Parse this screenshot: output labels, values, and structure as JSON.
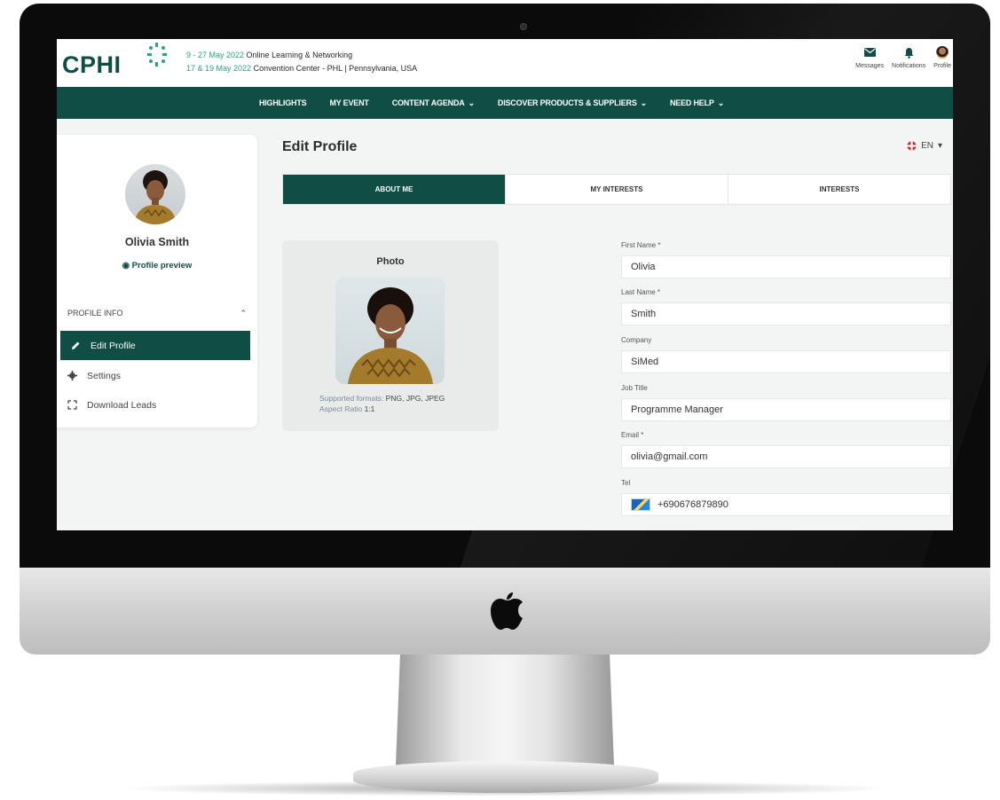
{
  "header": {
    "logo": "CPHI",
    "event_line1_date": "9 - 27 May 2022",
    "event_line1_text": " Online Learning & Networking",
    "event_line2_date": "17 & 19 May 2022",
    "event_line2_text": " Convention Center - PHL | Pennsylvania, USA",
    "icons": [
      {
        "label": "Messages",
        "icon": "envelope-icon"
      },
      {
        "label": "Notifications",
        "icon": "bell-icon"
      },
      {
        "label": "Profile",
        "icon": "avatar"
      }
    ]
  },
  "nav": {
    "items": [
      "HIGHLIGHTS",
      "MY EVENT",
      "CONTENT AGENDA",
      "DISCOVER PRODUCTS & SUPPLIERS",
      "NEED HELP"
    ],
    "dropdown_indicator": "⌄"
  },
  "sidebar": {
    "name": "Olivia Smith",
    "preview": "Profile preview",
    "section": "PROFILE INFO",
    "items": [
      {
        "label": "Edit Profile",
        "icon": "pencil-icon",
        "active": true
      },
      {
        "label": "Settings",
        "icon": "gear-icon",
        "active": false
      },
      {
        "label": "Download Leads",
        "icon": "download-frame-icon",
        "active": false
      }
    ]
  },
  "main": {
    "title": "Edit Profile",
    "language": "EN",
    "tabs": [
      "ABOUT ME",
      "MY INTERESTS",
      "INTERESTS"
    ],
    "active_tab": 0,
    "photo": {
      "label": "Photo",
      "formats_label": "Supported formats:",
      "formats_value": "PNG, JPG, JPEG",
      "ratio_label": "Aspect Ratio",
      "ratio_value": "1:1"
    },
    "form": {
      "first_name_label": "First Name *",
      "first_name": "Olivia",
      "last_name_label": "Last Name *",
      "last_name": "Smith",
      "company_label": "Company",
      "company": "SiMed",
      "job_title_label": "Job Title",
      "job_title": "Programme Manager",
      "email_label": "Email *",
      "email": "olivia@gmail.com",
      "tel_label": "Tel",
      "tel": "+690676879890"
    }
  },
  "colors": {
    "brand": "#0f4d45",
    "accent": "#2aa37e"
  }
}
